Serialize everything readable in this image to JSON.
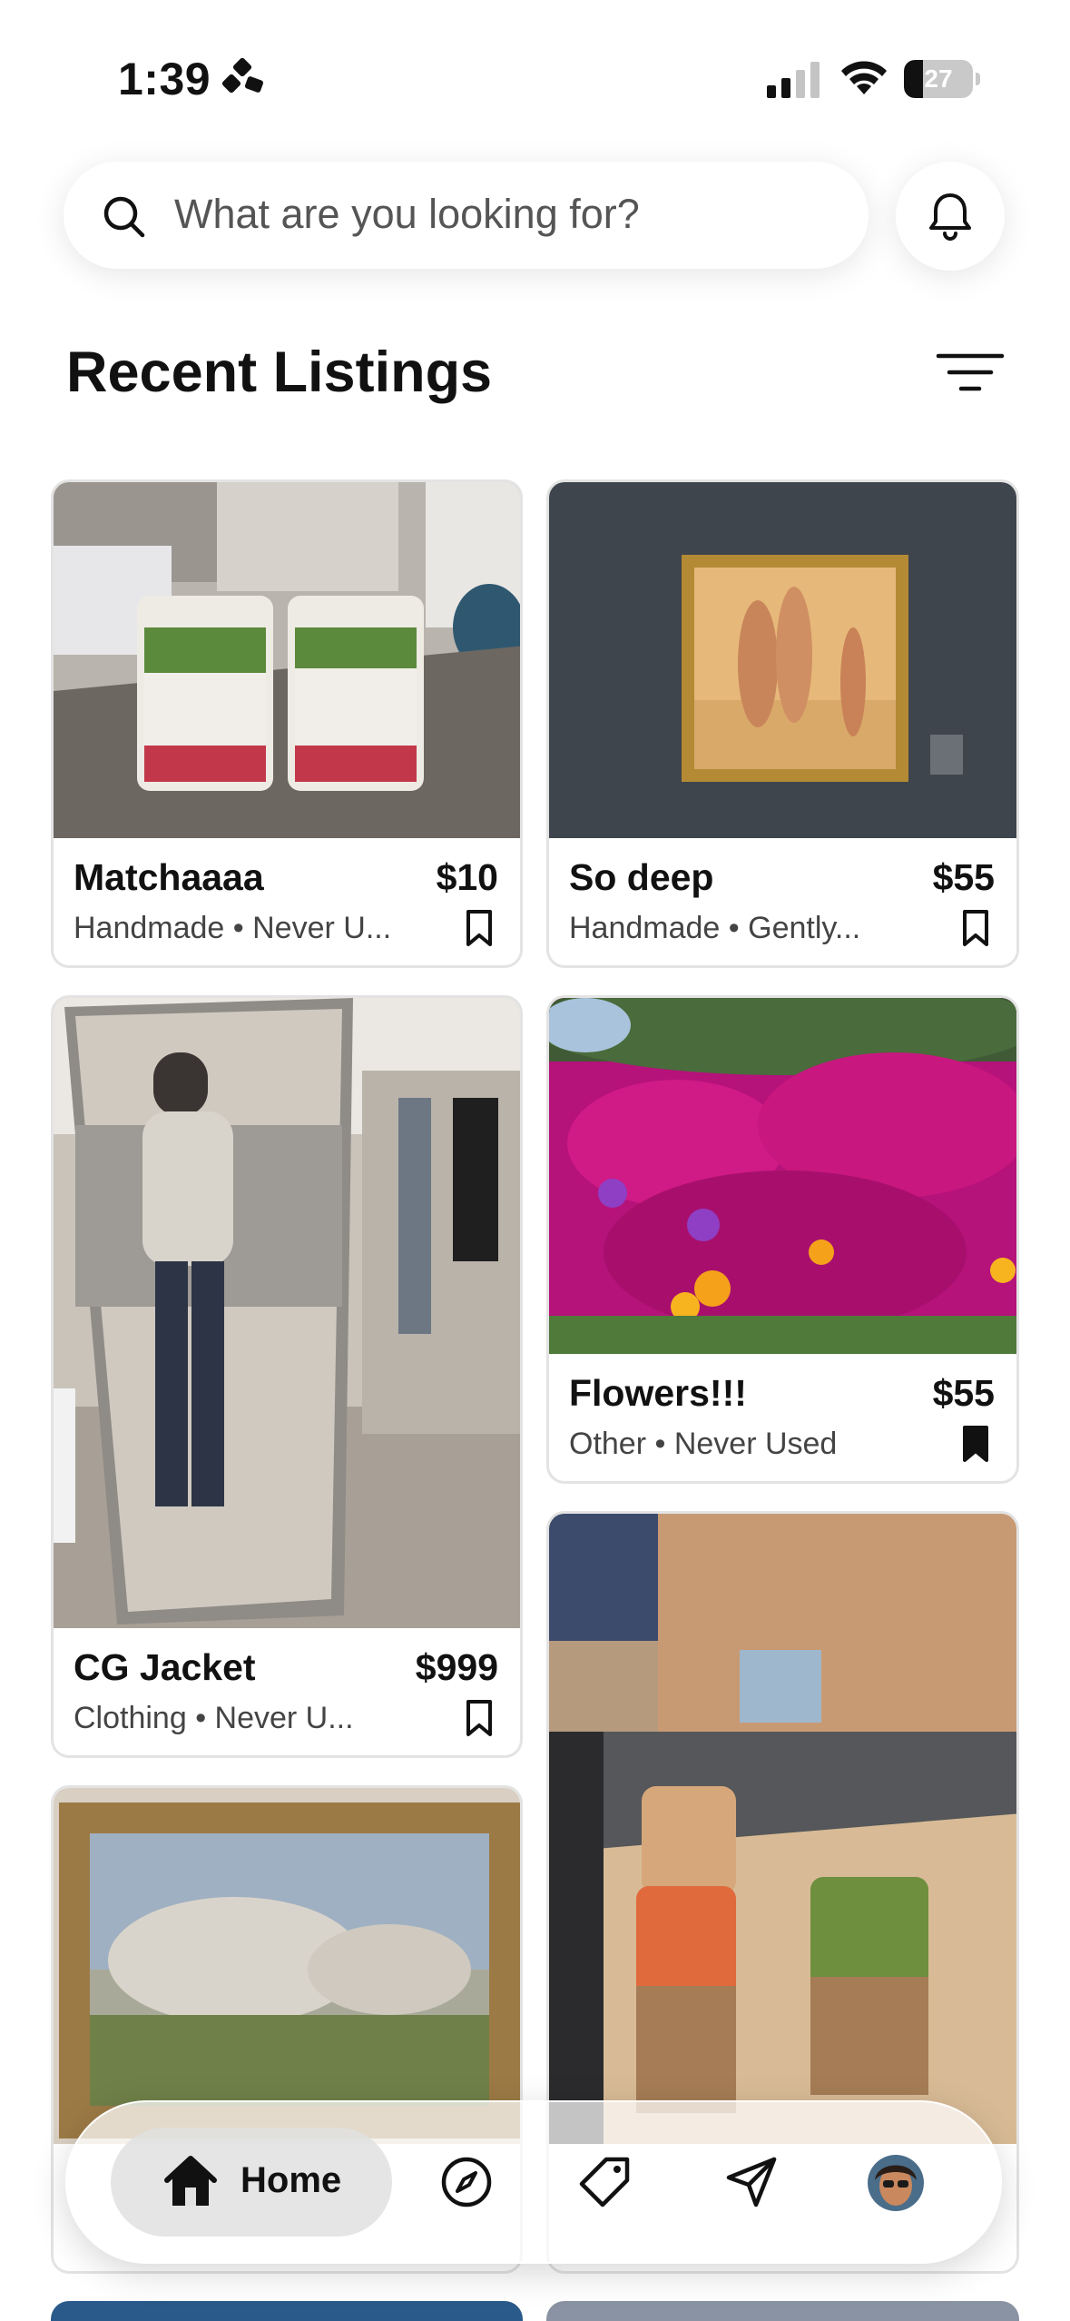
{
  "status_bar": {
    "time": "1:39",
    "battery_level": "27"
  },
  "search": {
    "placeholder": "What are you looking for?"
  },
  "section": {
    "title": "Recent Listings"
  },
  "listings": [
    {
      "title": "Matchaaaa",
      "price": "$10",
      "meta": "Handmade • Never U...",
      "saved": false
    },
    {
      "title": "So deep",
      "price": "$55",
      "meta": "Handmade • Gently...",
      "saved": false
    },
    {
      "title": "CG Jacket",
      "price": "$999",
      "meta": "Clothing • Never U...",
      "saved": false
    },
    {
      "title": "Flowers!!!",
      "price": "$55",
      "meta": "Other • Never Used",
      "saved": true
    }
  ],
  "nav": {
    "home_label": "Home"
  },
  "icons": [
    "search-icon",
    "bell-icon",
    "filter-icon",
    "bookmark-icon",
    "home-icon",
    "compass-icon",
    "tag-icon",
    "send-icon"
  ],
  "colors": {
    "background": "#ffffff",
    "text": "#111111",
    "muted_text": "#444444",
    "card_border": "#e3e3e3"
  }
}
